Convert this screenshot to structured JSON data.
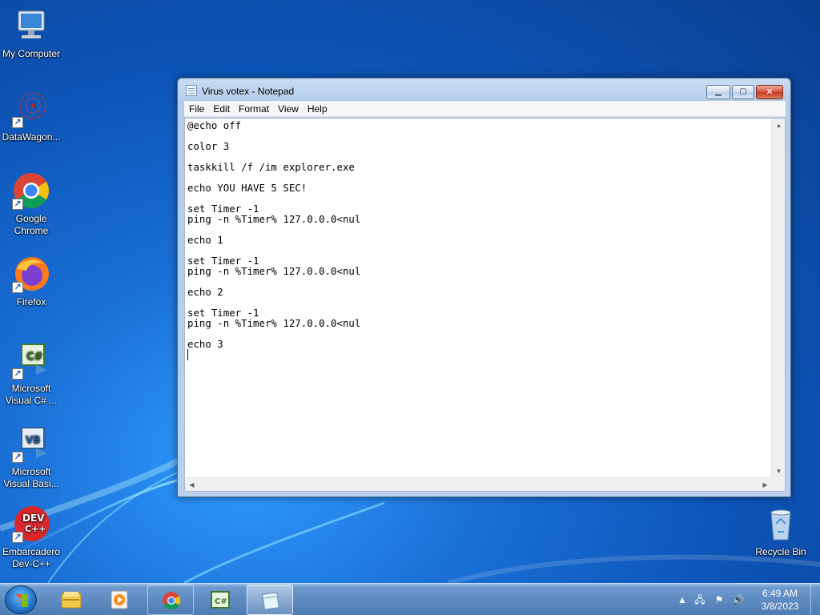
{
  "desktop": {
    "icons": [
      {
        "label": "My Computer",
        "icon": "computer-icon"
      },
      {
        "label": "DataWagon...",
        "icon": "datawagon-icon"
      },
      {
        "label": "Google Chrome",
        "icon": "chrome-icon"
      },
      {
        "label": "Firefox",
        "icon": "firefox-icon"
      },
      {
        "label": "Microsoft Visual C# ...",
        "icon": "visual-csharp-icon"
      },
      {
        "label": "Microsoft Visual Basi...",
        "icon": "visual-basic-icon"
      },
      {
        "label": "Embarcadero Dev-C++",
        "icon": "devcpp-icon"
      },
      {
        "label": "Recycle Bin",
        "icon": "recycle-bin-icon"
      }
    ]
  },
  "notepad": {
    "title": "Virus votex - Notepad",
    "menu": [
      "File",
      "Edit",
      "Format",
      "View",
      "Help"
    ],
    "lines": [
      "@echo off",
      "",
      "color 3",
      "",
      "taskkill /f /im explorer.exe",
      "",
      "echo YOU HAVE 5 SEC!",
      "",
      "set Timer -1",
      "ping -n %Timer% 127.0.0.0<nul",
      "",
      "echo 1",
      "",
      "set Timer -1",
      "ping -n %Timer% 127.0.0.0<nul",
      "",
      "echo 2",
      "",
      "set Timer -1",
      "ping -n %Timer% 127.0.0.0<nul",
      "",
      "echo 3"
    ]
  },
  "taskbar": {
    "items": [
      "explorer-icon",
      "media-player-icon",
      "chrome-icon",
      "visual-csharp-icon",
      "notepad-icon"
    ],
    "active_index": 4,
    "clock_time": "6:49 AM",
    "clock_date": "3/8/2023"
  },
  "colors": {
    "desktop_blue": "#1a6fd6",
    "close_red": "#c43a22"
  }
}
